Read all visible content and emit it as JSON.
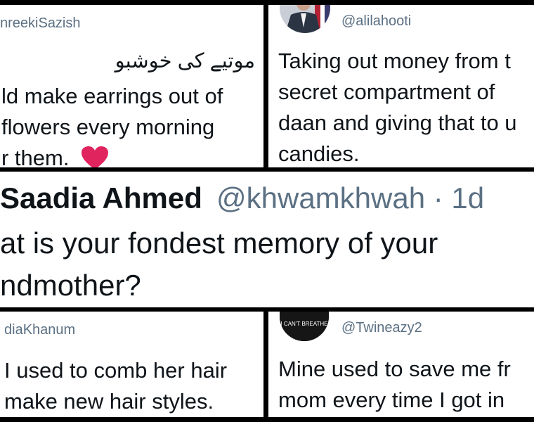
{
  "colors": {
    "text": "#0f1419",
    "handle": "#5b7083",
    "heart": "#e0245e",
    "border": "#000000"
  },
  "top_left": {
    "handle": "nreekiSazish",
    "urdu": "موتیے کی خوشبو",
    "lines": [
      "ld make earrings out of",
      "flowers every morning",
      "r them."
    ],
    "emoji": "heart-emoji"
  },
  "top_right": {
    "handle": "@alilahooti",
    "lines": [
      "Taking out money from t",
      "secret compartment of",
      "daan and giving that to u",
      "candies."
    ]
  },
  "main": {
    "name": "Saadia Ahmed",
    "meta": "@khwamkhwah · 1d",
    "lines": [
      "at is your fondest memory of your",
      "ndmother?"
    ]
  },
  "bottom_left": {
    "handle": "diaKhanum",
    "lines": [
      "I used to comb her hair",
      "make new hair styles."
    ]
  },
  "bottom_right": {
    "handle": "@Twineazy2",
    "avatar_text": "I CAN'T BREATHE",
    "lines": [
      "Mine used to save me fr",
      "mom every time I got in"
    ]
  }
}
